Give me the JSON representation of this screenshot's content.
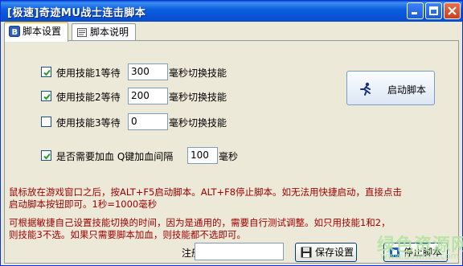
{
  "window": {
    "title": "[极速]奇迹MU战士连击脚本",
    "minimize_icon": "minimize-icon",
    "maximize_icon": "maximize-icon",
    "close_icon": "close-icon"
  },
  "tabs": [
    {
      "label": "脚本设置",
      "active": true,
      "icon": "b-icon"
    },
    {
      "label": "脚本说明",
      "active": false,
      "icon": "doc-icon"
    }
  ],
  "skills": [
    {
      "checked": true,
      "label": "使用技能1等待",
      "value": "300",
      "suffix": "毫秒切换技能"
    },
    {
      "checked": true,
      "label": "使用技能2等待",
      "value": "200",
      "suffix": "毫秒切换技能"
    },
    {
      "checked": false,
      "label": "使用技能3等待",
      "value": "0",
      "suffix": "毫秒切换技能"
    }
  ],
  "heal": {
    "checked": true,
    "label": "是否需要加血  Q键加血间隔",
    "value": "100",
    "suffix": "毫秒"
  },
  "start_button": {
    "label": "启动脚本",
    "icon": "runner-icon"
  },
  "info": {
    "line1": "鼠标放在游戏窗口之后，按ALT+F5启动脚本。ALT+F8停止脚本。如无法用快捷启动，直接点击",
    "line2": "启动脚本按钮即可。1秒=1000毫秒",
    "line3": "可根据敏捷自己设置技能切换的时间，因为是通用的，需要自行测试调整。如只用技能1和2，",
    "line4": "则技能3不选。如果只需要脚本加血，则技能都不选即可。"
  },
  "register": {
    "label": "注册码",
    "value": ""
  },
  "save_button": {
    "label": "保存设置",
    "icon": "floppy-icon"
  },
  "stop_button": {
    "label": "停止脚本",
    "icon": "stop-icon"
  },
  "watermark": {
    "text": "绿色资源网",
    "url": "www.downcc.com"
  },
  "colors": {
    "title_bar": "#0a5bd8",
    "info_text": "#a00000",
    "window_bg": "#ece9d8"
  }
}
